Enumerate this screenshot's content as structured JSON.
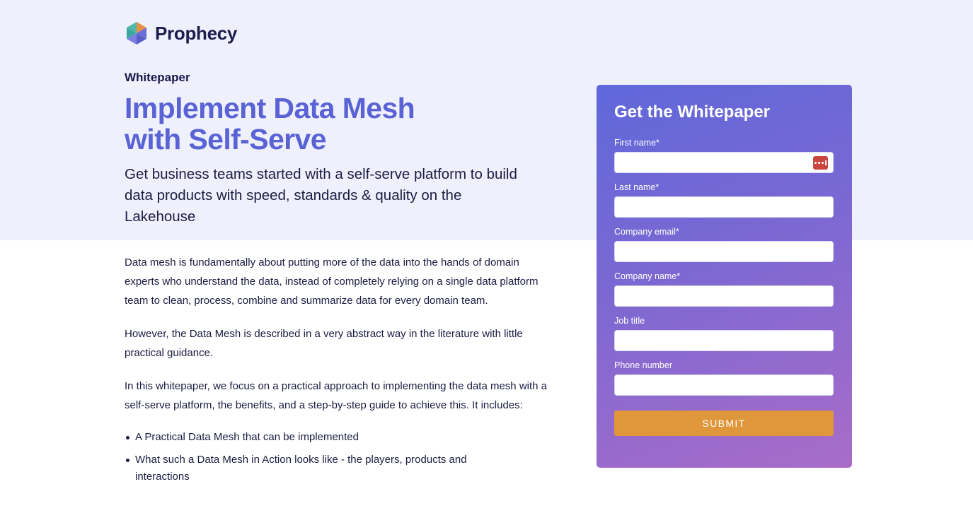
{
  "brand": {
    "name": "Prophecy",
    "logo_icon": "hexagon-logo-icon"
  },
  "hero": {
    "eyebrow": "Whitepaper",
    "title_line1": "Implement Data Mesh",
    "title_line2": "with Self-Serve",
    "subtitle": "Get business teams started with a self-serve platform to build data products with speed, standards & quality on the Lakehouse"
  },
  "body": {
    "paragraphs": [
      "Data mesh is fundamentally about putting more of the data into the hands of domain experts who understand the data, instead of completely relying on a single data platform team to clean, process, combine and summarize data for every domain team.",
      "However, the Data Mesh is described in a very abstract way in the literature with little practical guidance.",
      "In this whitepaper, we focus on a practical approach to implementing the data mesh with a self-serve platform, the benefits, and a step-by-step guide to achieve this. It includes:"
    ],
    "bullets": [
      "A Practical Data Mesh that can be implemented",
      "What such a Data Mesh in Action looks like - the players, products and interactions"
    ]
  },
  "form": {
    "title": "Get the Whitepaper",
    "fields": [
      {
        "label": "First name*",
        "value": ""
      },
      {
        "label": "Last name*",
        "value": ""
      },
      {
        "label": "Company email*",
        "value": ""
      },
      {
        "label": "Company name*",
        "value": ""
      },
      {
        "label": "Job title",
        "value": ""
      },
      {
        "label": "Phone number",
        "value": ""
      }
    ],
    "password_manager_icon": "password-manager-icon",
    "submit_label": "SUBMIT"
  },
  "colors": {
    "hero_background": "#eef0fc",
    "title": "#5a63d6",
    "form_gradient_start": "#5f68da",
    "form_gradient_end": "#a96cc9",
    "submit_button": "#e0963a"
  }
}
